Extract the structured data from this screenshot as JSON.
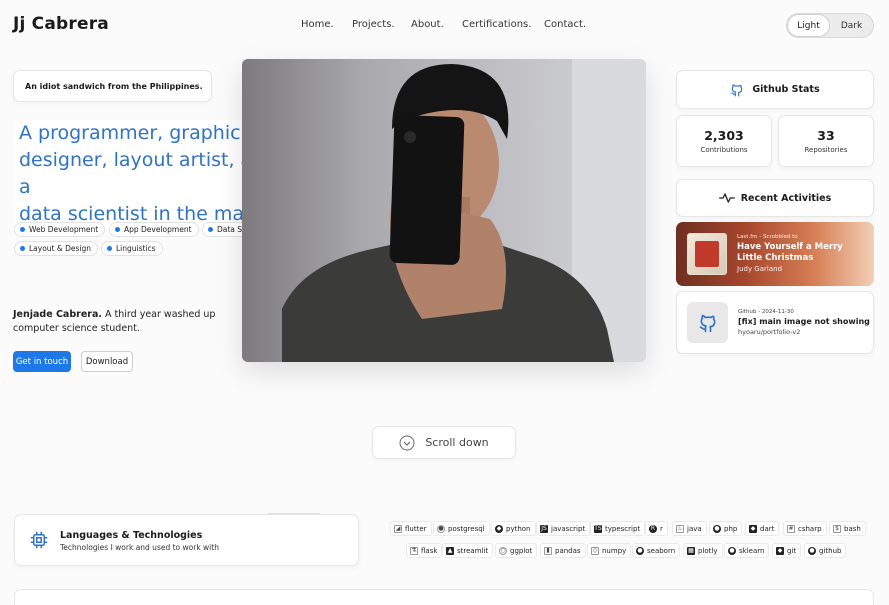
{
  "header": {
    "logo": "Jj Cabrera",
    "nav": [
      "Home.",
      "Projects.",
      "About.",
      "Certifications.",
      "Contact."
    ],
    "theme": {
      "light": "Light",
      "dark": "Dark",
      "selected": "Light"
    }
  },
  "hero": {
    "tagline": "An idiot sandwich from the Philippines.",
    "headline_lines": [
      "A programmer, graphic",
      "designer, layout artist, and a",
      "data scientist in the making."
    ],
    "skills": [
      "Web Development",
      "App Development",
      "Data Science",
      "Layout & Design",
      "Linguistics"
    ],
    "bio_name": "Jenjade Cabrera.",
    "bio_rest": "A third year washed up computer science student.",
    "primary_button": "Get in touch",
    "secondary_button": "Download"
  },
  "github": {
    "title": "Github Stats",
    "contributions": {
      "value": "2,303",
      "label": "Contributions"
    },
    "repositories": {
      "value": "33",
      "label": "Repositories"
    }
  },
  "activities": {
    "title": "Recent Activities",
    "music": {
      "source": "Last.fm - Scrobbled to",
      "song": "Have Yourself a Merry Little Christmas",
      "artist": "Judy Garland"
    },
    "commit": {
      "source": "Github - 2024-11-30",
      "message": "[fix] main image not showing",
      "repo": "hyoaru/portfolio-v2"
    }
  },
  "scroll": {
    "label": "Scroll down"
  },
  "languages": {
    "title": "Languages & Technologies",
    "subtitle": "Technologies I work and used to work with",
    "row1": [
      "flutter",
      "postgresql",
      "python",
      "javascript",
      "typescript",
      "r",
      "java",
      "php",
      "dart",
      "csharp",
      "bash"
    ],
    "row2": [
      "flask",
      "streamlit",
      "ggplot",
      "pandas",
      "numpy",
      "seaborn",
      "plotly",
      "sklearn",
      "git",
      "github"
    ]
  },
  "colors": {
    "accent": "#1f78e8",
    "headline": "#2f73c6"
  }
}
